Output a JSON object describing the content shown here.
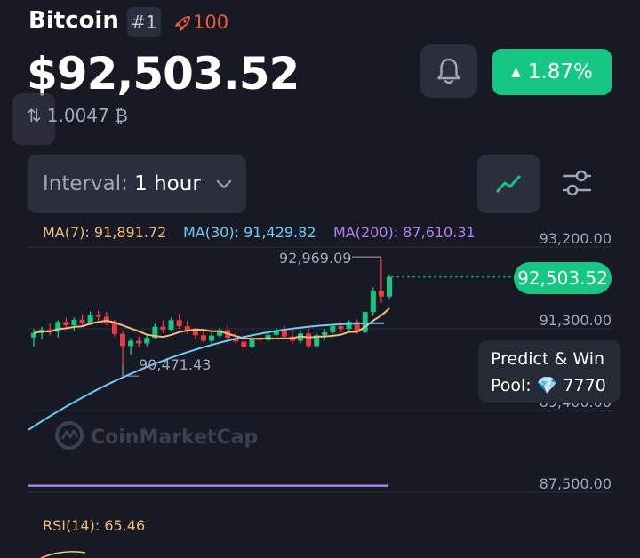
{
  "header": {
    "coin_name": "Bitcoin",
    "rank": "#1",
    "watchlist_count": "100",
    "price": "$92,503.52",
    "change_percent": "1.87%",
    "btc_value": "1.0047 ₿",
    "change_color": "#16c784",
    "watch_color": "#ea5a3c"
  },
  "controls": {
    "interval_label": "Interval:",
    "interval_value": "1 hour",
    "icons": [
      "bell-icon",
      "line-chart-icon",
      "settings-sliders-icon",
      "swap-arrows-icon",
      "chevron-down-icon",
      "rocket-icon"
    ]
  },
  "indicators": {
    "ma7": "MA(7): 91,891.72",
    "ma30": "MA(30): 91,429.82",
    "ma200": "MA(200): 87,610.31",
    "rsi": "RSI(14): 65.46",
    "ma7_color": "#f0b97d",
    "ma30_color": "#6ecbf5",
    "ma200_color": "#b37ef0"
  },
  "chart_data": {
    "type": "candlestick",
    "y_ticks": [
      "93,200.00",
      "91,300.00",
      "89,400.00",
      "87,500.00"
    ],
    "ylim": [
      86700,
      93800
    ],
    "current_price_label": "92,503.52",
    "current_price": 92503.52,
    "high_label": "92,969.09",
    "high": 92969.09,
    "low_label": "90,471.43",
    "low": 90471.43,
    "ma200_level": 87610.31,
    "up_color": "#16c784",
    "down_color": "#ea3943",
    "candles": [
      [
        91100,
        91300,
        90880,
        91200
      ],
      [
        91200,
        91350,
        91050,
        91280
      ],
      [
        91280,
        91420,
        91150,
        91230
      ],
      [
        91230,
        91500,
        91100,
        91460
      ],
      [
        91460,
        91560,
        91300,
        91380
      ],
      [
        91380,
        91560,
        91250,
        91510
      ],
      [
        91510,
        91640,
        91350,
        91440
      ],
      [
        91440,
        91700,
        91380,
        91620
      ],
      [
        91620,
        91720,
        91500,
        91580
      ],
      [
        91580,
        91690,
        91380,
        91420
      ],
      [
        91420,
        91500,
        91120,
        91180
      ],
      [
        91180,
        91260,
        90471.43,
        90900
      ],
      [
        90900,
        91080,
        90700,
        91020
      ],
      [
        91020,
        91120,
        90880,
        90960
      ],
      [
        90960,
        91150,
        90900,
        91090
      ],
      [
        91090,
        91420,
        91050,
        91350
      ],
      [
        91350,
        91500,
        91200,
        91280
      ],
      [
        91280,
        91560,
        91240,
        91500
      ],
      [
        91500,
        91640,
        91300,
        91360
      ],
      [
        91360,
        91480,
        91180,
        91260
      ],
      [
        91260,
        91330,
        91080,
        91150
      ],
      [
        91150,
        91260,
        90980,
        91020
      ],
      [
        91020,
        91200,
        90950,
        91140
      ],
      [
        91140,
        91330,
        91100,
        91270
      ],
      [
        91270,
        91400,
        91050,
        91090
      ],
      [
        91090,
        91220,
        90950,
        91000
      ],
      [
        91000,
        91180,
        90780,
        90880
      ],
      [
        90880,
        91120,
        90820,
        91080
      ],
      [
        91080,
        91200,
        90960,
        91040
      ],
      [
        91040,
        91200,
        91000,
        91160
      ],
      [
        91160,
        91330,
        91120,
        91260
      ],
      [
        91260,
        91380,
        91080,
        91120
      ],
      [
        91120,
        91280,
        90950,
        91020
      ],
      [
        91020,
        91230,
        90960,
        91190
      ],
      [
        91190,
        91300,
        90850,
        90900
      ],
      [
        90900,
        91200,
        90860,
        91150
      ],
      [
        91150,
        91290,
        91030,
        91220
      ],
      [
        91220,
        91400,
        91180,
        91360
      ],
      [
        91360,
        91460,
        91220,
        91300
      ],
      [
        91300,
        91500,
        91260,
        91460
      ],
      [
        91460,
        91520,
        91180,
        91220
      ],
      [
        91220,
        91700,
        91200,
        91690
      ],
      [
        91690,
        92260,
        91600,
        92180
      ],
      [
        92180,
        92969.09,
        91900,
        92050
      ],
      [
        92050,
        92560,
        92000,
        92503.52
      ]
    ]
  },
  "overlays": {
    "predict_line1": "Predict & Win",
    "predict_line2": "Pool: 💎 7770",
    "watermark": "CoinMarketCap"
  }
}
